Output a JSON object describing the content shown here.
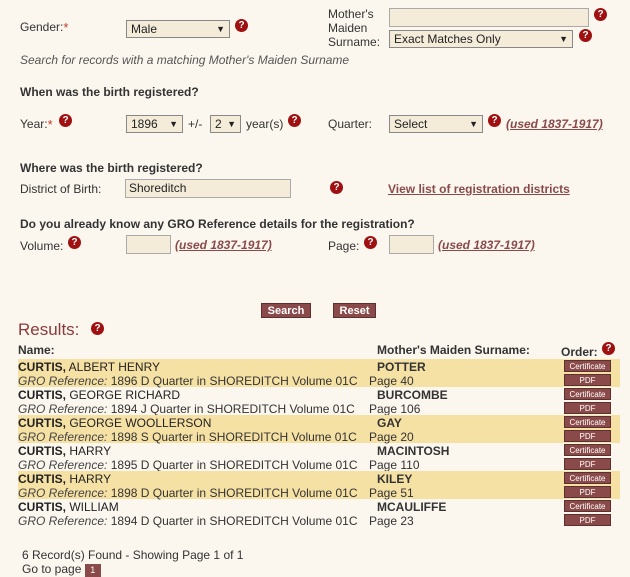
{
  "gender": {
    "label": "Gender:",
    "value": "Male"
  },
  "maiden": {
    "label_lines": [
      "Mother's",
      "Maiden",
      "Surname:"
    ],
    "value": "",
    "match": "Exact Matches Only"
  },
  "search_note": "Search for records with a matching Mother's Maiden Surname",
  "birth_when": {
    "heading": "When was the birth registered?",
    "year_label": "Year:",
    "year_value": "1896",
    "plusminus": "+/-",
    "range_value": "2",
    "range_unit": "year(s)",
    "quarter_label": "Quarter:",
    "quarter_value": "Select",
    "quarter_note": "(used 1837-1917)"
  },
  "birth_where": {
    "heading": "Where was the birth registered?",
    "district_label": "District of Birth:",
    "district_value": "Shoreditch",
    "districts_link": "View list of registration districts"
  },
  "gro": {
    "heading": "Do you already know any GRO Reference details for the registration?",
    "volume_label": "Volume:",
    "volume_note": "(used 1837-1917)",
    "page_label": "Page:",
    "page_note": "(used 1837-1917)"
  },
  "buttons": {
    "search": "Search",
    "reset": "Reset"
  },
  "results": {
    "title": "Results:",
    "col_name": "Name:",
    "col_maiden": "Mother's Maiden Surname:",
    "col_order": "Order:",
    "certificate_label": "Certificate",
    "pdf_label": "PDF",
    "gro_prefix": "GRO Reference:",
    "rows": [
      {
        "surname": "CURTIS,",
        "forenames": "ALBERT  HENRY",
        "maiden": "POTTER",
        "ref": "1896  D Quarter in SHOREDITCH  Volume 01C",
        "page": "Page 40"
      },
      {
        "surname": "CURTIS,",
        "forenames": "GEORGE  RICHARD",
        "maiden": "BURCOMBE",
        "ref": "1894  J Quarter in SHOREDITCH  Volume 01C",
        "page": "Page 106"
      },
      {
        "surname": "CURTIS,",
        "forenames": "GEORGE  WOOLLERSON",
        "maiden": "GAY",
        "ref": "1898  S Quarter in SHOREDITCH  Volume 01C",
        "page": "Page 20"
      },
      {
        "surname": "CURTIS,",
        "forenames": "HARRY",
        "maiden": "MACINTOSH",
        "ref": "1895  D Quarter in SHOREDITCH  Volume 01C",
        "page": "Page 110"
      },
      {
        "surname": "CURTIS,",
        "forenames": "HARRY",
        "maiden": "KILEY",
        "ref": "1898  D Quarter in SHOREDITCH  Volume 01C",
        "page": "Page 51"
      },
      {
        "surname": "CURTIS,",
        "forenames": "WILLIAM",
        "maiden": "MCAULIFFE",
        "ref": "1894  D Quarter in SHOREDITCH  Volume 01C",
        "page": "Page 23"
      }
    ],
    "summary": "6 Record(s) Found - Showing Page 1 of 1",
    "goto_label": "Go to page",
    "goto_page": "1"
  }
}
